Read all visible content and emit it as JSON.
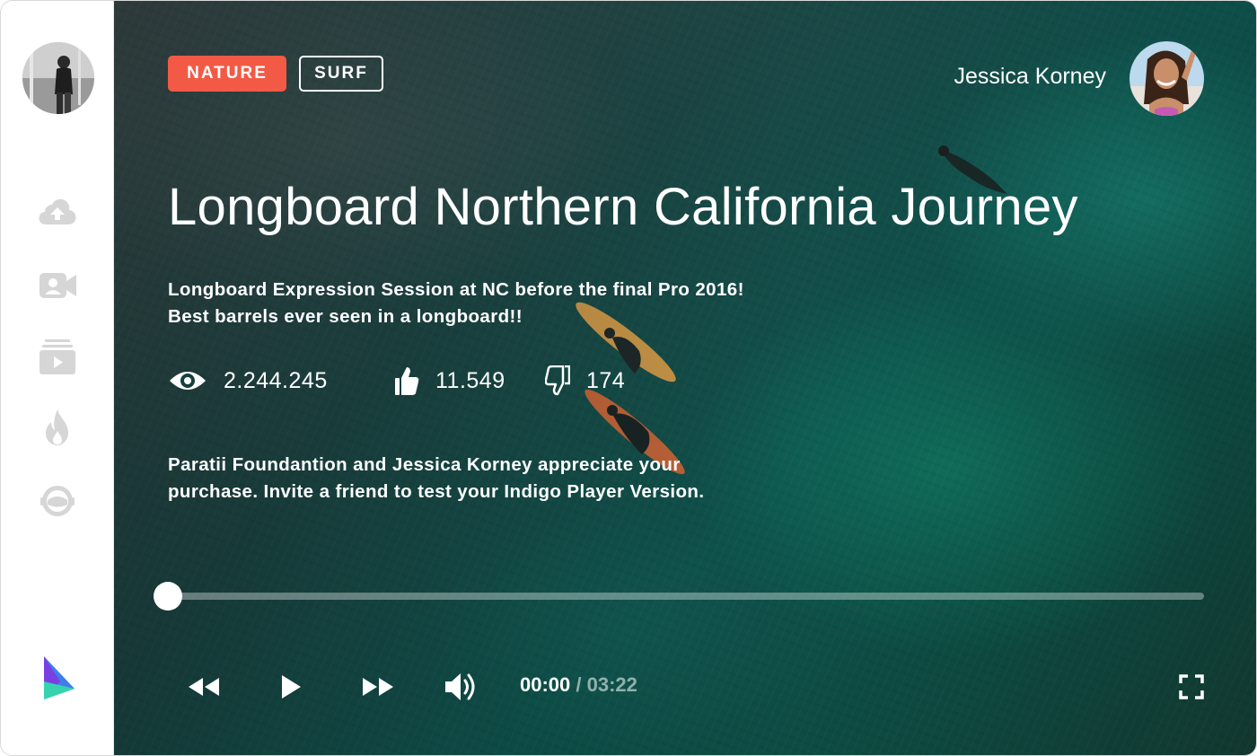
{
  "sidebar": {
    "items": [
      {
        "icon": "upload-cloud-icon"
      },
      {
        "icon": "video-camera-icon"
      },
      {
        "icon": "playlist-icon"
      },
      {
        "icon": "flame-icon"
      },
      {
        "icon": "astronaut-icon"
      }
    ],
    "colors": {
      "icon": "#d3d3d3",
      "logo_a": "#3f7ee8",
      "logo_b": "#7a3fe3",
      "logo_c": "#35d3b0"
    }
  },
  "video": {
    "tags": [
      "NATURE",
      "SURF"
    ],
    "author": "Jessica Korney",
    "title": "Longboard Northern California Journey",
    "description": [
      "Longboard Expression Session at NC before the final Pro 2016!",
      "Best barrels ever seen in a longboard!!"
    ],
    "stats": {
      "views": "2.244.245",
      "likes": "11.549",
      "dislikes": "174"
    },
    "note": [
      "Paratii Foundantion and Jessica Korney appreciate your",
      "purchase. Invite a friend to test your Indigo Player Version."
    ]
  },
  "player": {
    "progress": 0.0,
    "current_time": "00:00",
    "total_time": "/ 03:22"
  },
  "colors": {
    "accent": "#f35a45",
    "text": "#ffffff"
  }
}
